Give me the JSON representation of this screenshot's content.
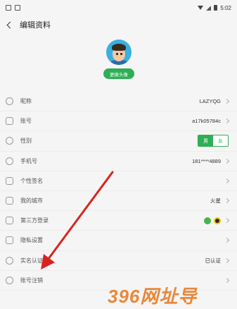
{
  "status": {
    "time": "5:02"
  },
  "nav": {
    "title": "编辑资料"
  },
  "profile": {
    "change_avatar_label": "更换头像"
  },
  "rows": [
    {
      "label": "昵称",
      "value": "LAZYQG",
      "icon": "person-icon"
    },
    {
      "label": "账号",
      "value": "a17k05784c",
      "icon": "id-card-icon"
    },
    {
      "label": "性别",
      "male": "男",
      "female": "女",
      "selected": "男",
      "icon": "gender-icon"
    },
    {
      "label": "手机号",
      "value": "181****4889",
      "icon": "phone-icon"
    },
    {
      "label": "个性签名",
      "value": "",
      "icon": "edit-icon"
    },
    {
      "label": "我的城市",
      "value": "火星",
      "icon": "city-icon"
    },
    {
      "label": "第三方登录",
      "icon": "link-icon",
      "providers": [
        "wechat-icon",
        "qq-icon"
      ]
    },
    {
      "label": "隐私设置",
      "value": "",
      "icon": "privacy-icon"
    },
    {
      "label": "实名认证",
      "value": "已认证",
      "icon": "verify-icon"
    },
    {
      "label": "账号注销",
      "value": "",
      "icon": "cancel-account-icon"
    }
  ],
  "watermark": "396网址导",
  "colors": {
    "accent": "#2eae55",
    "arrow": "#d9231e",
    "watermark": "#e8883a"
  }
}
